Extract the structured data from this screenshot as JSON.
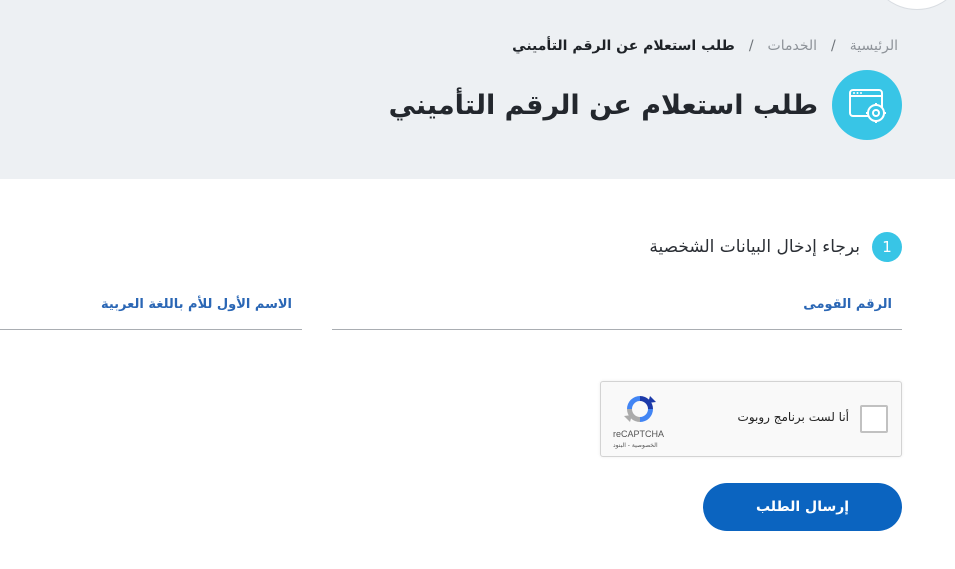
{
  "breadcrumb": {
    "home": "الرئيسية",
    "services": "الخدمات",
    "separator": "/",
    "current": "طلب استعلام عن الرقم التأميني"
  },
  "header": {
    "title": "طلب استعلام عن الرقم التأميني",
    "icon": "browser-settings-icon",
    "accent_color": "#38c5e6"
  },
  "step": {
    "number": "1",
    "title": "برجاء إدخال البيانات الشخصية"
  },
  "form": {
    "national_id_label": "الرقم القومى",
    "mother_first_name_label": "الاسم الأول للأم باللغة العربية"
  },
  "recaptcha": {
    "label": "أنا لست برنامج روبوت",
    "brand": "reCAPTCHA",
    "links": "الخصوصية - البنود"
  },
  "submit": {
    "label": "إرسال الطلب",
    "color": "#0b64c0"
  }
}
